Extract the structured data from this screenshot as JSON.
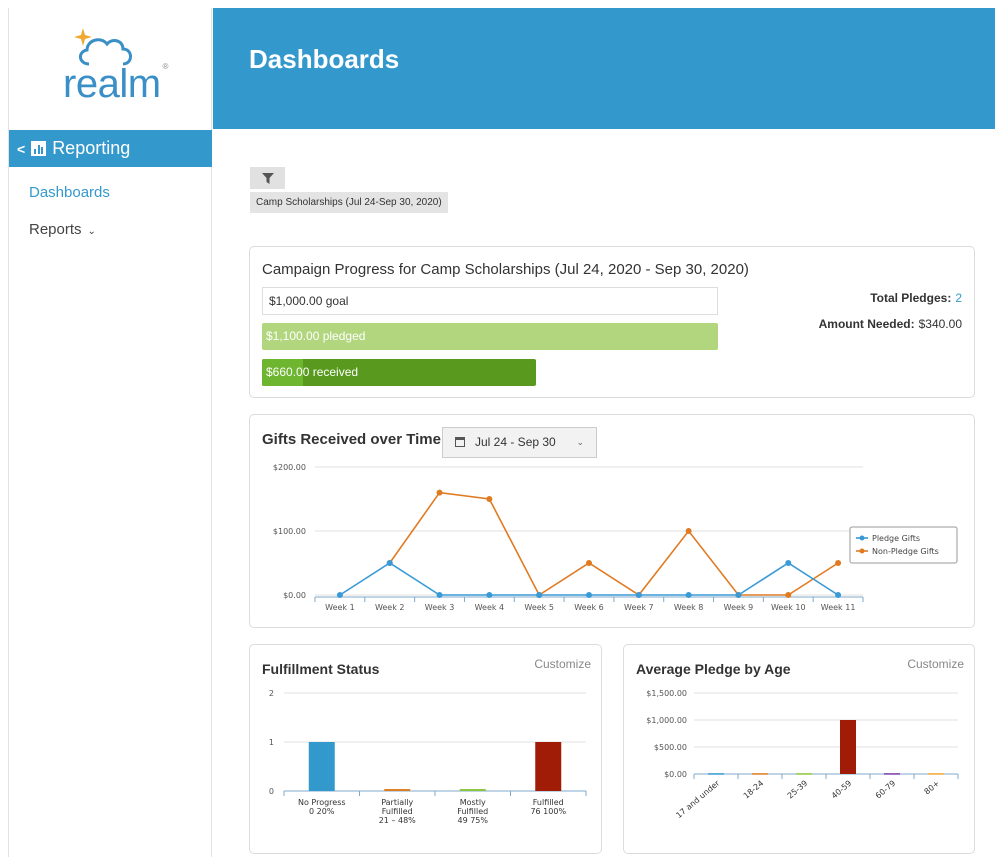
{
  "app": {
    "logo_text": "realm",
    "page_title": "Dashboards"
  },
  "sidebar": {
    "section_label": "Reporting",
    "items": [
      {
        "label": "Dashboards"
      },
      {
        "label": "Reports"
      }
    ]
  },
  "filter": {
    "tag": "Camp Scholarships (Jul 24-Sep 30, 2020)"
  },
  "campaign": {
    "title": "Campaign Progress for Camp Scholarships (Jul 24, 2020 - Sep 30, 2020)",
    "goal_label": "$1,000.00 goal",
    "pledged_label": "$1,100.00 pledged",
    "received_label": "$660.00 received",
    "total_pledges_label": "Total Pledges:",
    "total_pledges_value": "2",
    "amount_needed_label": "Amount Needed:",
    "amount_needed_value": "$340.00",
    "colors": {
      "pledged": "#b1d67d",
      "received": "#599a1e"
    }
  },
  "gifts": {
    "title": "Gifts Received over Time",
    "date_range": "Jul 24 - Sep 30"
  },
  "fulfillment": {
    "title": "Fulfillment Status",
    "customize": "Customize"
  },
  "age": {
    "title": "Average Pledge by Age",
    "customize": "Customize"
  },
  "chart_data": [
    {
      "type": "line",
      "title": "Gifts Received over Time",
      "categories": [
        "Week 1",
        "Week 2",
        "Week 3",
        "Week 4",
        "Week 5",
        "Week 6",
        "Week 7",
        "Week 8",
        "Week 9",
        "Week 10",
        "Week 11"
      ],
      "y_ticks": [
        "$0.00",
        "$100.00",
        "$200.00"
      ],
      "ylim": [
        0,
        200
      ],
      "grid": true,
      "legend_position": "right",
      "series": [
        {
          "name": "Pledge Gifts",
          "color": "#3a9ad6",
          "values": [
            0,
            50,
            0,
            0,
            0,
            0,
            0,
            0,
            0,
            50,
            0
          ]
        },
        {
          "name": "Non-Pledge Gifts",
          "color": "#e07b22",
          "values": [
            null,
            50,
            160,
            150,
            0,
            50,
            0,
            100,
            0,
            0,
            50
          ]
        }
      ]
    },
    {
      "type": "bar",
      "title": "Fulfillment Status",
      "categories": [
        {
          "label": "No Progress",
          "range": "0    20%",
          "color": "#3399cc"
        },
        {
          "label": "Partially Fulfilled",
          "range": "21 – 48%",
          "color": "#e07b22"
        },
        {
          "label": "Mostly Fulfilled",
          "range": "49    75%",
          "color": "#8cc63f"
        },
        {
          "label": "Fulfilled",
          "range": "76    100%",
          "color": "#a11c07"
        }
      ],
      "values": [
        1,
        0.04,
        0.04,
        1
      ],
      "y_ticks": [
        "0",
        "1",
        "2"
      ],
      "ylim": [
        0,
        2
      ],
      "grid": true
    },
    {
      "type": "bar",
      "title": "Average Pledge by Age",
      "categories": [
        "17 and under",
        "18-24",
        "25-39",
        "40-59",
        "60-79",
        "80+"
      ],
      "colors": [
        "#3399cc",
        "#e07b22",
        "#8cc63f",
        "#a11c07",
        "#7a3ba8",
        "#f0a830"
      ],
      "values": [
        15,
        15,
        15,
        1000,
        15,
        15
      ],
      "y_ticks": [
        "$0.00",
        "$500.00",
        "$1,000.00",
        "$1,500.00"
      ],
      "ylim": [
        0,
        1500
      ],
      "grid": true
    }
  ]
}
